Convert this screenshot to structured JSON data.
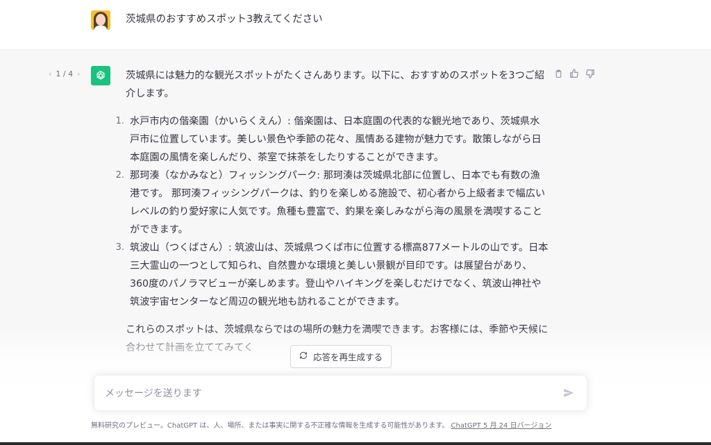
{
  "user_message": {
    "text": "茨城県のおすすめスポット3教えてください"
  },
  "assistant": {
    "pager": {
      "prev": "‹",
      "label": "1 / 4",
      "next": "›"
    },
    "intro": "茨城県には魅力的な観光スポットがたくさんあります。以下に、おすすめのスポットを3つご紹介します。",
    "items": [
      {
        "num": "1.",
        "text": "水戸市内の偕楽園（かいらくえん）: 偕楽園は、日本庭園の代表的な観光地であり、茨城県水戸市に位置しています。美しい景色や季節の花々、風情ある建物が魅力です。散策しながら日本庭園の風情を楽しんだり、茶室で抹茶をしたりすることができます。"
      },
      {
        "num": "2.",
        "text": "那珂湊（なかみなと）フィッシングパーク: 那珂湊は茨城県北部に位置し、日本でも有数の漁港です。 那珂湊フィッシングパークは、釣りを楽しめる施設で、初心者から上級者まで幅広いレベルの釣り愛好家に人気です。魚種も豊富で、釣果を楽しみながら海の風景を満喫することができます。"
      },
      {
        "num": "3.",
        "text": "筑波山（つくばさん）: 筑波山は、茨城県つくば市に位置する標高877メートルの山です。日本三大霊山の一つとして知られ、自然豊かな環境と美しい景観が目印です。は展望台があり、360度のパノラマビューが楽しめます。登山やハイキングを楽しむだけでなく、筑波山神社や筑波宇宙センターなど周辺の観光地も訪れることができます。"
      }
    ],
    "outro": "これらのスポットは、茨城県ならではの場所の魅力を満喫できます。お客様には、季節や天候に合わせて計画を立ててみてく"
  },
  "regenerate": {
    "label": "応答を再生成する"
  },
  "composer": {
    "placeholder": "メッセージを送ります",
    "value": ""
  },
  "footer": {
    "text": "無料研究のプレビュー。ChatGPT は、人、場所、または事実に関する不正確な情報を生成する可能性があります。",
    "link": "ChatGPT 5 月 24 日バージョン"
  },
  "icons": {
    "bot_avatar": "openai-logo-icon",
    "copy": "clipboard-icon",
    "like": "thumbs-up-icon",
    "dislike": "thumbs-down-icon",
    "regenerate": "refresh-icon",
    "send": "send-icon"
  },
  "colors": {
    "bot_avatar_bg": "#19c37d",
    "assistant_bg": "#f7f7f8",
    "user_avatar_bg": "#f2c230"
  }
}
